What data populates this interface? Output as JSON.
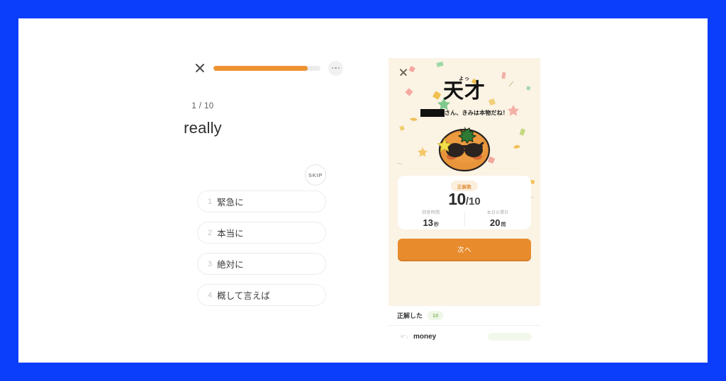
{
  "theme": {
    "frame_blue": "#0b3efa",
    "accent_orange": "#ee9233",
    "card_cream": "#fbf3e4",
    "badge_green": "#8cbf6c"
  },
  "quiz": {
    "close_icon": "close-icon",
    "more_icon": "more-options-icon",
    "progress_percent": 88,
    "counter": "1 / 10",
    "prompt_word": "really",
    "skip_label": "SKIP",
    "options": [
      {
        "num": "1",
        "label": "緊急に"
      },
      {
        "num": "2",
        "label": "本当に"
      },
      {
        "num": "3",
        "label": "絶対に"
      },
      {
        "num": "4",
        "label": "概して言えば"
      }
    ]
  },
  "result": {
    "close_icon": "close-icon",
    "furigana": "よっ",
    "headline": "天才",
    "redacted_name": "",
    "subline": "さん、きみは本物だね！",
    "mascot_icon": "mandarin-sunglasses-mascot",
    "stats": {
      "badge": "正解数",
      "score_main": "10",
      "score_sub": "/10",
      "cells": [
        {
          "label": "回答時間",
          "value": "13",
          "unit": "秒"
        },
        {
          "label": "本日の累計",
          "value": "20",
          "unit": "問"
        }
      ]
    },
    "next_label": "次へ"
  },
  "list": {
    "section_title": "正解した",
    "section_count": "10",
    "rows": [
      {
        "audio_icon": "speaker-icon",
        "word": "money"
      }
    ]
  }
}
